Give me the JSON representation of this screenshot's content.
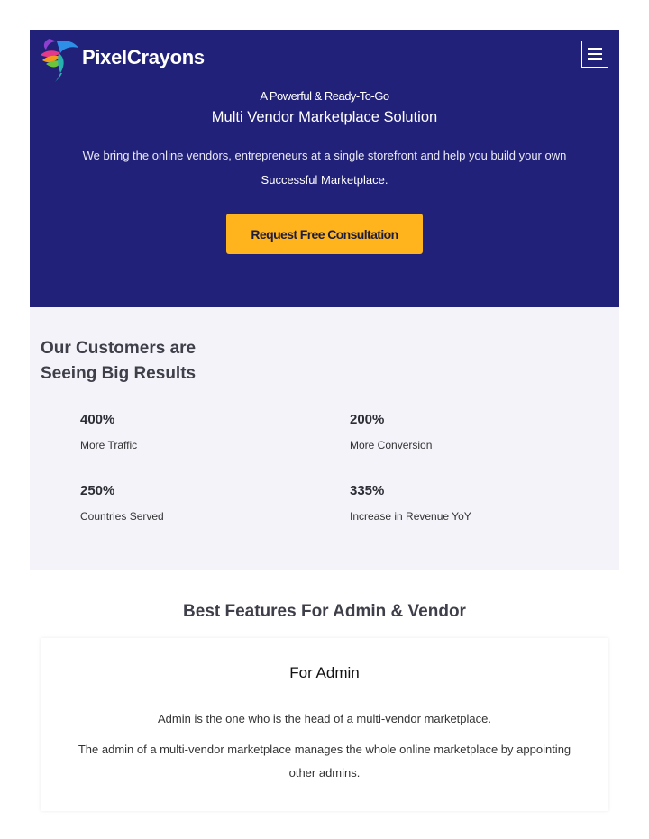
{
  "brand": {
    "name": "PixelCrayons",
    "colors": {
      "hero_bg": "#22217a",
      "cta_bg": "#ffb41e",
      "results_bg": "#f3f3f9"
    }
  },
  "header": {
    "menu_icon": "hamburger-menu-icon"
  },
  "hero": {
    "eyebrow": "A Powerful & Ready-To-Go",
    "title": "Multi Vendor Marketplace Solution",
    "description": "We bring the online vendors, entrepreneurs at a single storefront and help you build your own",
    "description_highlight": "Successful Marketplace.",
    "cta_label": "Request Free Consultation"
  },
  "results": {
    "title": "Our Customers are Seeing Big Results",
    "stats": [
      {
        "value": "400%",
        "label": "More Traffic"
      },
      {
        "value": "200%",
        "label": "More Conversion"
      },
      {
        "value": "250%",
        "label": "Countries Served"
      },
      {
        "value": "335%",
        "label": "Increase in Revenue YoY"
      }
    ]
  },
  "features": {
    "title": "Best Features For Admin & Vendor",
    "admin_card": {
      "title": "For Admin",
      "paragraph1": "Admin is the one who is the head of a multi-vendor marketplace.",
      "paragraph2": "The admin of a multi-vendor marketplace manages the whole online marketplace by appointing other admins."
    }
  }
}
